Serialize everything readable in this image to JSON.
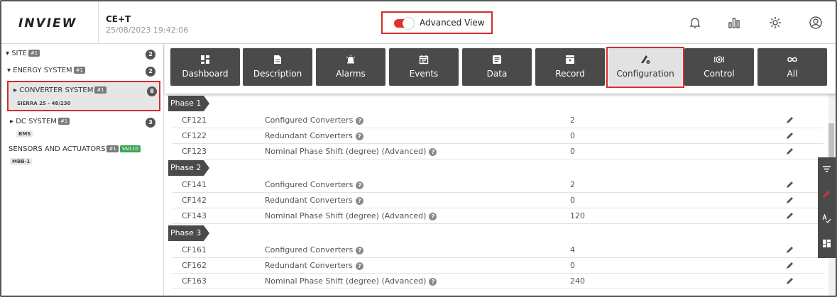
{
  "header": {
    "logo": "INVIEW",
    "device_name": "CE+T",
    "timestamp": "25/08/2023 19:42:06",
    "advanced_view_label": "Advanced View",
    "advanced_view_on": true,
    "icons": [
      "bell-icon",
      "bar-chart-icon",
      "gear-icon",
      "user-icon"
    ]
  },
  "sidebar": {
    "site": {
      "label": "SITE",
      "tag": "#1",
      "count": "2"
    },
    "energy_system": {
      "label": "ENERGY SYSTEM",
      "tag": "#1",
      "count": "2"
    },
    "converter_system": {
      "label": "CONVERTER SYSTEM",
      "tag": "#1",
      "sub": "SIERRA 25 - 48/230",
      "count": "8"
    },
    "dc_system": {
      "label": "DC SYSTEM",
      "tag": "#1",
      "sub": "BMS",
      "count": "3"
    },
    "sensors": {
      "label": "SENSORS AND ACTUATORS",
      "tag": "#1",
      "tag2": "SN110",
      "sub": "MBB-1"
    }
  },
  "toolbar": {
    "buttons": [
      {
        "label": "Dashboard",
        "icon": "dashboard-icon"
      },
      {
        "label": "Description",
        "icon": "document-icon"
      },
      {
        "label": "Alarms",
        "icon": "alarm-icon"
      },
      {
        "label": "Events",
        "icon": "calendar-icon"
      },
      {
        "label": "Data",
        "icon": "list-icon"
      },
      {
        "label": "Record",
        "icon": "record-icon"
      },
      {
        "label": "Configuration",
        "icon": "configuration-icon"
      },
      {
        "label": "Control",
        "icon": "control-icon"
      },
      {
        "label": "All",
        "icon": "infinity-icon"
      }
    ],
    "active": "Configuration"
  },
  "phases": [
    {
      "label": "Phase 1",
      "rows": [
        {
          "code": "CF121",
          "name": "Configured Converters",
          "value": "2"
        },
        {
          "code": "CF122",
          "name": "Redundant Converters",
          "value": "0"
        },
        {
          "code": "CF123",
          "name": "Nominal Phase Shift (degree) (Advanced)",
          "value": "0"
        }
      ]
    },
    {
      "label": "Phase 2",
      "rows": [
        {
          "code": "CF141",
          "name": "Configured Converters",
          "value": "2"
        },
        {
          "code": "CF142",
          "name": "Redundant Converters",
          "value": "0"
        },
        {
          "code": "CF143",
          "name": "Nominal Phase Shift (degree) (Advanced)",
          "value": "120"
        }
      ]
    },
    {
      "label": "Phase 3",
      "rows": [
        {
          "code": "CF161",
          "name": "Configured Converters",
          "value": "4"
        },
        {
          "code": "CF162",
          "name": "Redundant Converters",
          "value": "0"
        },
        {
          "code": "CF163",
          "name": "Nominal Phase Shift (degree) (Advanced)",
          "value": "240"
        }
      ]
    }
  ],
  "dock": [
    "filter-icon",
    "edit-icon",
    "spellcheck-icon",
    "grid-icon"
  ],
  "colors": {
    "accent_red": "#d62b2b",
    "toolbar_dark": "#4a4a4a",
    "tag_green": "#3aa655"
  }
}
